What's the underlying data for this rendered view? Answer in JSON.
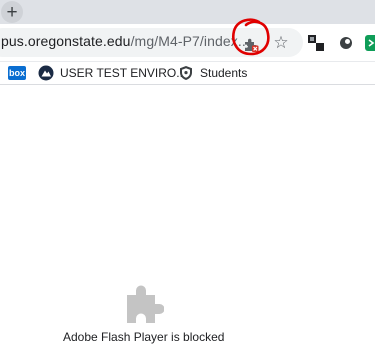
{
  "tabstrip": {
    "new_tab_label": "+"
  },
  "omnibox": {
    "url_main": "pus.oregonstate.edu",
    "url_path": "/mg/M4-P7/index...."
  },
  "toolbar": {
    "plugin_icon": "plugin-blocked-icon",
    "star_icon": "bookmark-star-icon",
    "star_glyph": "☆"
  },
  "bookmarks": [
    {
      "icon": "box-icon",
      "icon_text": "box",
      "label": ""
    },
    {
      "icon": "test-env-icon",
      "label": "USER TEST ENVIRO..."
    },
    {
      "icon": "shield-icon",
      "label": "Students"
    }
  ],
  "content": {
    "blocked_message": "Adobe Flash Player is blocked",
    "blocked_icon": "puzzle-piece-icon"
  },
  "colors": {
    "annotation": "#e00000",
    "accent": "#0a6ed1",
    "plugin_gray": "#c4c4c4"
  }
}
